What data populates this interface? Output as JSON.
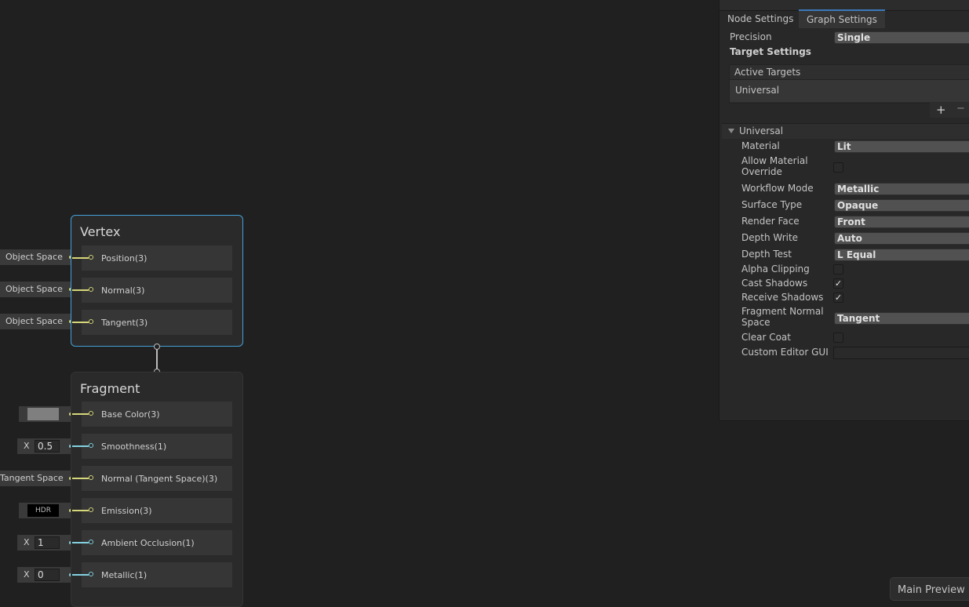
{
  "vertex": {
    "title": "Vertex",
    "ports": [
      {
        "label": "Position(3)",
        "input": "Object Space"
      },
      {
        "label": "Normal(3)",
        "input": "Object Space"
      },
      {
        "label": "Tangent(3)",
        "input": "Object Space"
      }
    ]
  },
  "fragment": {
    "title": "Fragment",
    "ports": [
      {
        "label": "Base Color(3)",
        "color": "#7f7f7f"
      },
      {
        "label": "Smoothness(1)",
        "axis": "X",
        "value": "0.5"
      },
      {
        "label": "Normal (Tangent Space)(3)",
        "input": "Tangent Space"
      },
      {
        "label": "Emission(3)",
        "swatch_text": "HDR"
      },
      {
        "label": "Ambient Occlusion(1)",
        "axis": "X",
        "value": "1"
      },
      {
        "label": "Metallic(1)",
        "axis": "X",
        "value": "0"
      }
    ]
  },
  "inspector": {
    "tabs": [
      "Node Settings",
      "Graph Settings"
    ],
    "active_tab": "Graph Settings",
    "precision_label": "Precision",
    "precision_value": "Single",
    "target_settings_label": "Target Settings",
    "active_targets_header": "Active Targets",
    "active_targets": [
      "Universal"
    ],
    "add_glyph": "+",
    "remove_glyph": "−",
    "section_title": "Universal",
    "settings": {
      "material": {
        "label": "Material",
        "value": "Lit"
      },
      "allow_override": {
        "label1": "Allow Material",
        "label2": "Override",
        "checked": false
      },
      "workflow": {
        "label": "Workflow Mode",
        "value": "Metallic"
      },
      "surface": {
        "label": "Surface Type",
        "value": "Opaque"
      },
      "render_face": {
        "label": "Render Face",
        "value": "Front"
      },
      "depth_write": {
        "label": "Depth Write",
        "value": "Auto"
      },
      "depth_test": {
        "label": "Depth Test",
        "value": "L Equal"
      },
      "alpha_clipping": {
        "label": "Alpha Clipping",
        "checked": false
      },
      "cast_shadows": {
        "label": "Cast Shadows",
        "checked": true
      },
      "receive_shadows": {
        "label": "Receive Shadows",
        "checked": true
      },
      "fragment_normal": {
        "label1": "Fragment Normal",
        "label2": "Space",
        "value": "Tangent"
      },
      "clear_coat": {
        "label": "Clear Coat",
        "checked": false
      },
      "custom_gui": {
        "label": "Custom Editor GUI",
        "value": ""
      }
    },
    "check_glyph": "✓"
  },
  "main_preview": {
    "label": "Main Preview"
  },
  "colors": {
    "vector3": "#d6d67a",
    "vector1": "#84d1e0",
    "selection": "#44a0d8",
    "tab_accent": "#3a79bb"
  }
}
